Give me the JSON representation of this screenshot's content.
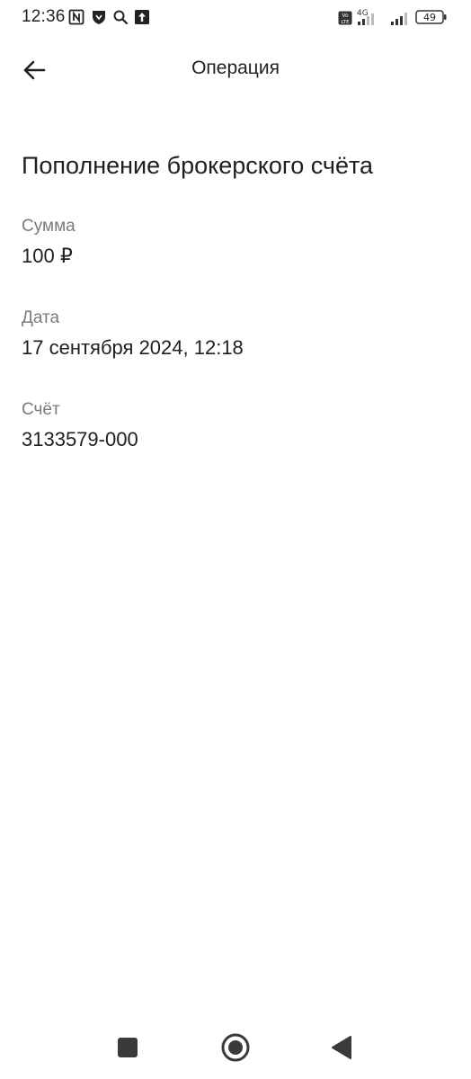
{
  "status_bar": {
    "time": "12:36",
    "battery_level": "49",
    "left_icons": [
      "nfc-icon",
      "shield-icon",
      "search-icon",
      "upload-icon"
    ],
    "right_icons": [
      "volte-icon",
      "signal-4g-icon",
      "signal-icon",
      "battery-icon"
    ]
  },
  "app_bar": {
    "title": "Операция",
    "back_icon": "arrow-left-icon"
  },
  "operation": {
    "heading": "Пополнение брокерского счёта",
    "fields": [
      {
        "label": "Сумма",
        "value": "100 ₽"
      },
      {
        "label": "Дата",
        "value": "17 сентября 2024, 12:18"
      },
      {
        "label": "Счёт",
        "value": "3133579-000"
      }
    ]
  },
  "nav_bar": {
    "buttons": [
      "recents-square-icon",
      "home-circle-icon",
      "back-triangle-icon"
    ]
  },
  "colors": {
    "background": "#ffffff",
    "text_primary": "#1f1f1f",
    "text_secondary": "#7b7b7b"
  }
}
